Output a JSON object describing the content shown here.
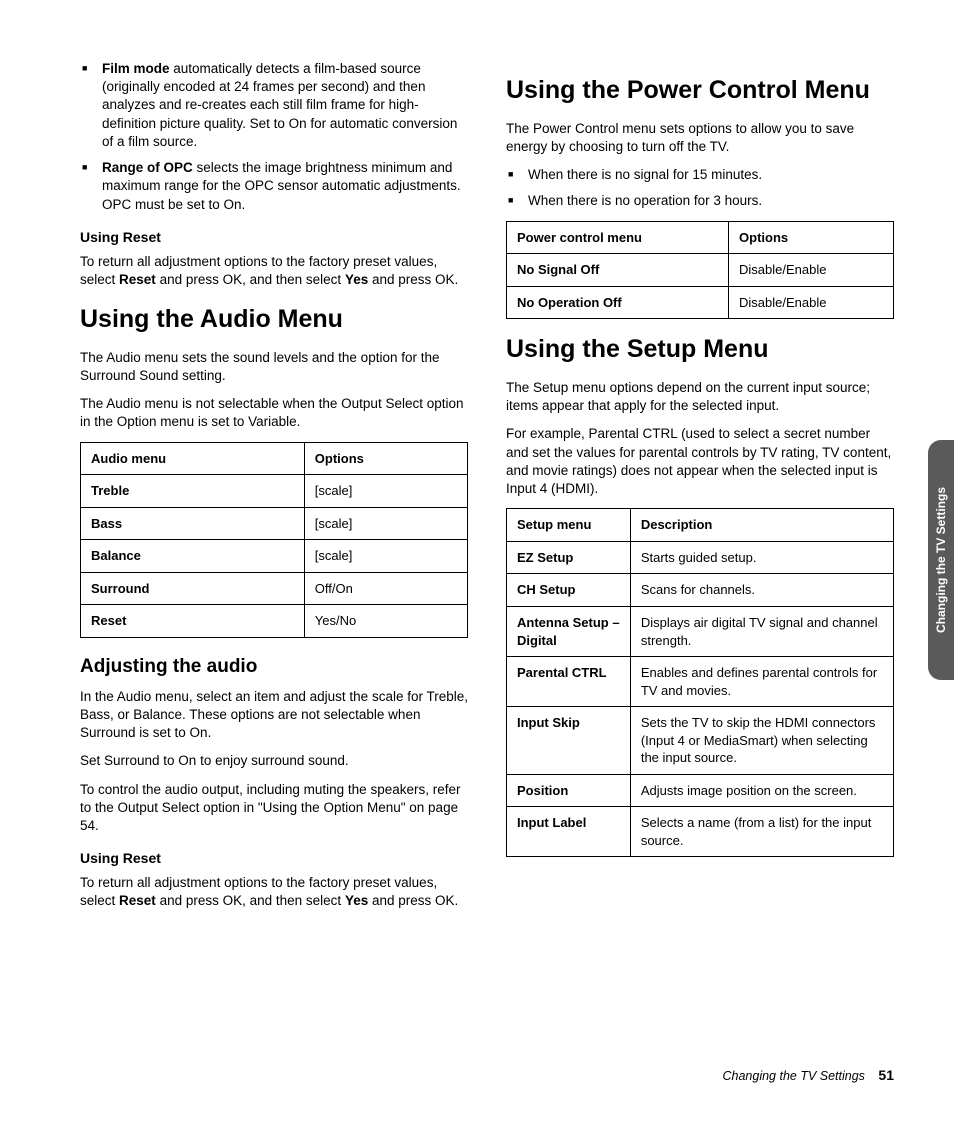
{
  "left": {
    "bullets": [
      {
        "label": "Film mode",
        "text": " automatically detects a film-based source (originally encoded at 24 frames per second) and then analyzes and re-creates each still film frame for high-definition picture quality. Set to On for automatic conversion of a film source."
      },
      {
        "label": "Range of OPC",
        "text": " selects the image brightness minimum and maximum range for the OPC sensor automatic adjustments. OPC must be set to On."
      }
    ],
    "reset1_h": "Using Reset",
    "reset1_p_a": "To return all adjustment options to the factory preset values, select ",
    "reset1_b1": "Reset",
    "reset1_p_b": " and press OK, and then select ",
    "reset1_b2": "Yes",
    "reset1_p_c": " and press OK.",
    "audio_h": "Using the Audio Menu",
    "audio_p1": "The Audio menu sets the sound levels and the option for the Surround Sound setting.",
    "audio_p2": "The Audio menu is not selectable when the Output Select option in the Option menu is set to Variable.",
    "audio_table": {
      "h1": "Audio menu",
      "h2": "Options",
      "rows": [
        [
          "Treble",
          "[scale]"
        ],
        [
          "Bass",
          "[scale]"
        ],
        [
          "Balance",
          "[scale]"
        ],
        [
          "Surround",
          "Off/On"
        ],
        [
          "Reset",
          "Yes/No"
        ]
      ]
    },
    "adj_h": "Adjusting the audio",
    "adj_p1": "In the Audio menu, select an item and adjust the scale for Treble, Bass, or Balance. These options are not selectable when Surround is set to On.",
    "adj_p2": "Set Surround to On to enjoy surround sound.",
    "adj_p3": "To control the audio output, including muting the speakers, refer to the Output Select option in \"Using the Option Menu\" on page 54.",
    "reset2_h": "Using Reset",
    "reset2_p_a": "To return all adjustment options to the factory preset values, select ",
    "reset2_b1": "Reset",
    "reset2_p_b": " and press OK, and then select ",
    "reset2_b2": "Yes",
    "reset2_p_c": " and press OK."
  },
  "right": {
    "power_h": "Using the Power Control Menu",
    "power_p": "The Power Control menu sets options to allow you to save energy by choosing to turn off the TV.",
    "power_bullets": [
      "When there is no signal for 15 minutes.",
      "When there is no operation for 3 hours."
    ],
    "power_table": {
      "h1": "Power control menu",
      "h2": "Options",
      "rows": [
        [
          "No Signal Off",
          "Disable/Enable"
        ],
        [
          "No Operation Off",
          "Disable/Enable"
        ]
      ]
    },
    "setup_h": "Using the Setup Menu",
    "setup_p1": "The Setup menu options depend on the current input source; items appear that apply for the selected input.",
    "setup_p2": "For example, Parental CTRL (used to select a secret number and set the values for parental controls by TV rating, TV content, and movie ratings) does not appear when the selected input is Input 4 (HDMI).",
    "setup_table": {
      "h1": "Setup menu",
      "h2": "Description",
      "rows": [
        [
          "EZ Setup",
          "Starts guided setup."
        ],
        [
          "CH Setup",
          "Scans for channels."
        ],
        [
          "Antenna Setup – Digital",
          "Displays air digital TV signal and channel strength."
        ],
        [
          "Parental CTRL",
          "Enables and defines parental controls for TV and movies."
        ],
        [
          "Input Skip",
          "Sets the TV to skip the HDMI connectors (Input 4 or MediaSmart) when selecting the input source."
        ],
        [
          "Position",
          "Adjusts image position on the screen."
        ],
        [
          "Input Label",
          "Selects a name (from a list) for the input source."
        ]
      ]
    }
  },
  "tab": "Changing the TV Settings",
  "footer_text": "Changing the TV Settings",
  "footer_page": "51"
}
